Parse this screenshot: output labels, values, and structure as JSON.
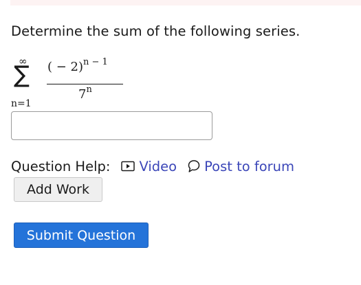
{
  "question": {
    "prompt": "Determine the sum of the following series.",
    "series": {
      "sum_symbol": "∑",
      "upper_limit": "∞",
      "lower_limit": "n=1",
      "numerator_base": "( − 2)",
      "numerator_exponent": "n − 1",
      "denominator_base": "7",
      "denominator_exponent": "n"
    }
  },
  "answer": {
    "value": "",
    "placeholder": ""
  },
  "help": {
    "label": "Question Help:",
    "video_label": "Video",
    "video_icon": "video-play-icon",
    "forum_label": "Post to forum",
    "forum_icon": "speech-bubble-icon"
  },
  "buttons": {
    "add_work": "Add Work",
    "submit": "Submit Question"
  },
  "colors": {
    "link": "#3b46b8",
    "submit_bg": "#2473d9",
    "top_band": "#fdf3f3"
  }
}
